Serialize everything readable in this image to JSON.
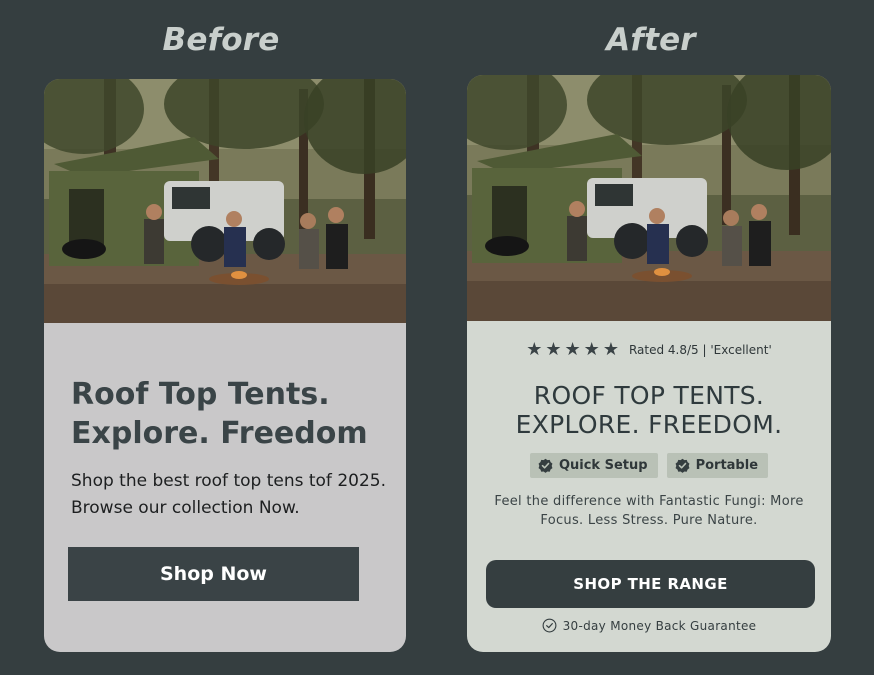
{
  "labels": {
    "before": "Before",
    "after": "After"
  },
  "before_card": {
    "image_icon": "camping-scene-photo",
    "headline_line1": "Roof Top Tents.",
    "headline_line2": "Explore. Freedom",
    "body": "Shop the best roof top tens tof 2025. Browse our collection Now.",
    "button_label": "Shop Now"
  },
  "after_card": {
    "image_icon": "camping-scene-photo",
    "stars": 5,
    "rating_text": "Rated 4.8/5 | 'Excellent'",
    "headline_line1": "ROOF TOP TENTS.",
    "headline_line2": "EXPLORE. FREEDOM.",
    "badges": [
      {
        "label": "Quick Setup",
        "icon": "verified-check-icon"
      },
      {
        "label": "Portable",
        "icon": "verified-check-icon"
      }
    ],
    "body_line1": "Feel the difference with Fantastic Fungi: More",
    "body_line2": "Focus. Less Stress. Pure Nature.",
    "button_label": "SHOP THE RANGE",
    "guarantee_text": "30-day Money Back Guarantee",
    "guarantee_icon": "check-circle-icon"
  },
  "colors": {
    "background": "#353e40",
    "before_card_bg": "#c9c8c9",
    "after_card_bg": "#d3d8d1",
    "button_bg": "#3a4346",
    "badge_bg": "#b9c1b6"
  }
}
